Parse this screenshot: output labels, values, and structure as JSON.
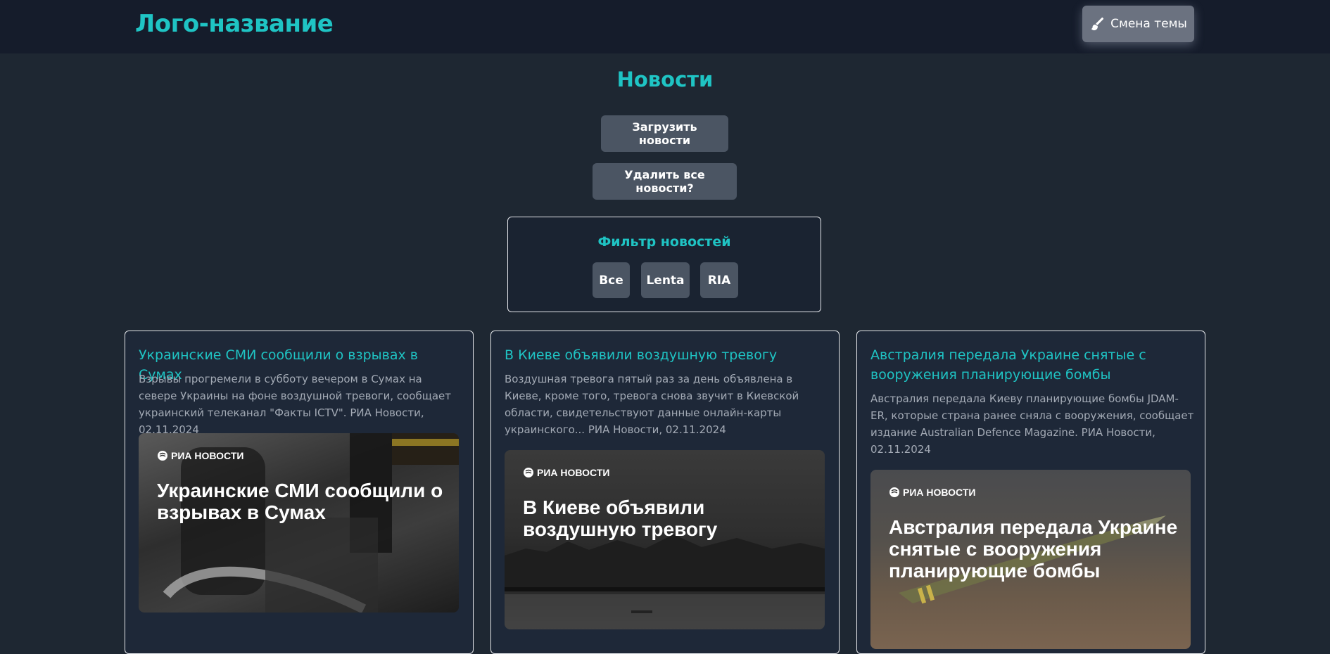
{
  "header": {
    "logo": "Лого-название",
    "theme_button": "Смена темы",
    "theme_icon": "paint-brush-icon"
  },
  "main": {
    "title": "Новости",
    "load_button": "Загрузить новости",
    "delete_button": "Удалить все новости?"
  },
  "filter": {
    "title": "Фильтр новостей",
    "options": [
      "Все",
      "Lenta",
      "RIA"
    ]
  },
  "news": [
    {
      "title": "Украинские СМИ сообщили о взрывах в Сумах",
      "description": "Взрывы прогремели в субботу вечером в Сумах на севере Украины на фоне воздушной тревоги, сообщает украинский телеканал \"Факты ICTV\". РИА Новости, 02.11.2024",
      "image": {
        "brand": "РИА НОВОСТИ",
        "headline": "Украинские СМИ сообщили о взрывах в Сумах"
      }
    },
    {
      "title": "В Киеве объявили воздушную тревогу",
      "description": "Воздушная тревога пятый раз за день объявлена в Киеве, кроме того, тревога снова звучит в Киевской области, свидетельствуют данные онлайн-карты украинского... РИА Новости, 02.11.2024",
      "image": {
        "brand": "РИА НОВОСТИ",
        "headline": "В Киеве объявили воздушную тревогу"
      }
    },
    {
      "title": "Австралия передала Украине снятые с вооружения планирующие бомбы",
      "description": "Австралия передала Киеву планирующие бомбы JDAM-ER, которые страна ранее сняла с вооружения, сообщает издание Australian Defence Magazine. РИА Новости, 02.11.2024",
      "image": {
        "brand": "РИА НОВОСТИ",
        "headline": "Австралия передала Украине снятые с вооружения планирующие бомбы"
      }
    }
  ],
  "colors": {
    "accent": "#1fc4c4",
    "header_bg": "#151c2b",
    "page_bg": "#1e2732",
    "button_bg": "#4b5563"
  }
}
